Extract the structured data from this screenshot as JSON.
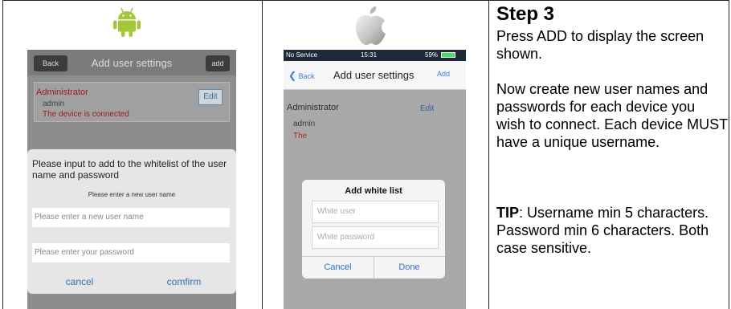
{
  "android": {
    "header": {
      "back_label": "Back",
      "title": "Add user settings",
      "add_label": "add"
    },
    "card": {
      "role": "Administrator",
      "username": "admin",
      "status": "The device is connected",
      "edit_label": "Edit"
    },
    "dialog": {
      "message": "Please input to add to the whitelist of the user name and password",
      "hint": "Please enter a new user name",
      "username_placeholder": "Please enter a new user name",
      "password_placeholder": "Please enter your password",
      "cancel_label": "cancel",
      "confirm_label": "comfirm"
    }
  },
  "ios": {
    "status_bar": {
      "carrier": "No Service",
      "time": "15:31",
      "battery": "59%"
    },
    "nav": {
      "back_label": "Back",
      "title": "Add user settings",
      "add_label": "Add"
    },
    "card": {
      "role": "Administrator",
      "username": "admin",
      "status": "The",
      "edit_label": "Edit"
    },
    "dialog": {
      "title": "Add white list",
      "username_placeholder": "White user",
      "password_placeholder": "White password",
      "cancel_label": "Cancel",
      "done_label": "Done"
    }
  },
  "instructions": {
    "heading": "Step 3",
    "paragraph1": "Press ADD to display the screen shown.",
    "paragraph2": "Now create new user names and passwords for each device you wish to connect. Each device MUST have a unique username.",
    "tip_label": "TIP",
    "tip_text": ": Username min 5 characters. Password min 6 characters. Both case sensitive."
  },
  "colors": {
    "android_green": "#a4c639",
    "ios_blue": "#2e6fc6",
    "error_red": "#b22222"
  },
  "icons": {
    "android": "android-robot-icon",
    "apple": "apple-logo-icon"
  }
}
